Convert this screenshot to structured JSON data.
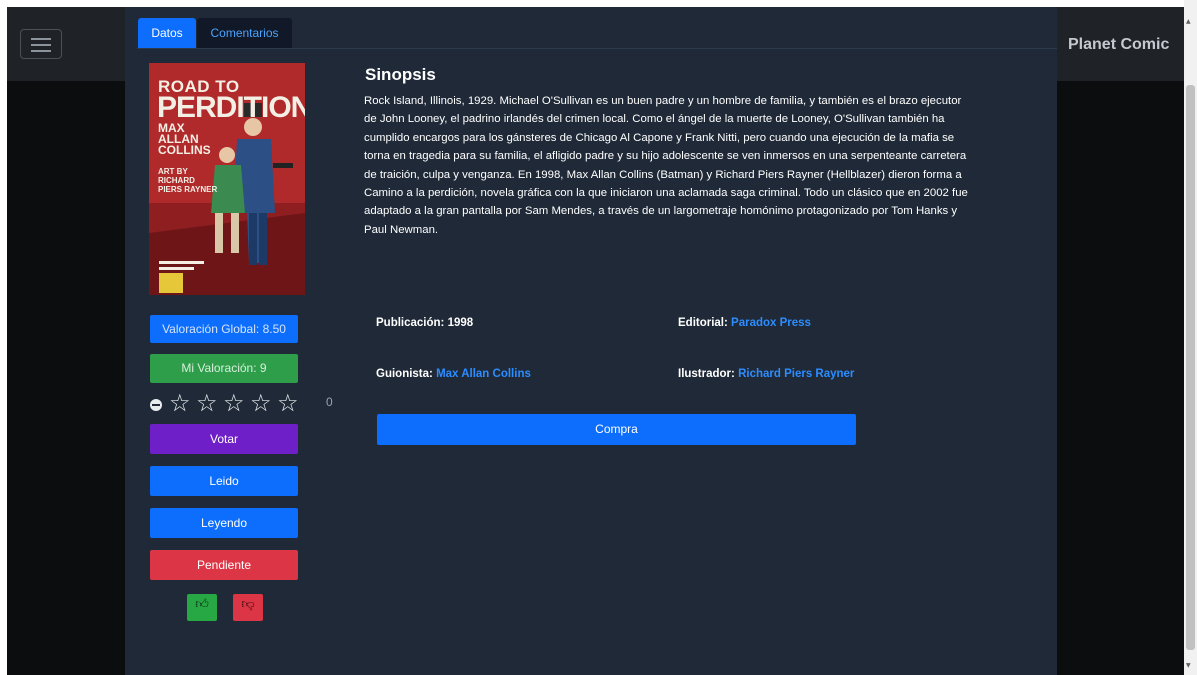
{
  "navbar": {
    "brand": "Planet Comic"
  },
  "tabs": [
    {
      "label": "Datos",
      "active": true
    },
    {
      "label": "Comentarios",
      "active": false
    }
  ],
  "cover": {
    "title_line1": "ROAD TO",
    "title_line2": "PERDITION",
    "author": "MAX ALLAN COLLINS",
    "art": "ART BY RICHARD PIERS RAYNER"
  },
  "ratings": {
    "global_label": "Valoración Global: 8.50",
    "mine_label": "Mi Valoración: 9",
    "stars_total": 5,
    "count": "0"
  },
  "actions": {
    "votar": "Votar",
    "leido": "Leido",
    "leyendo": "Leyendo",
    "pendiente": "Pendiente",
    "like_icon": "thumbs-up-icon",
    "dislike_icon": "thumbs-down-icon"
  },
  "sinopsis": {
    "title": "Sinopsis",
    "text": "Rock Island, Illinois, 1929. Michael O'Sullivan es un buen padre y un hombre de familia, y también es el brazo ejecutor de John Looney, el padrino irlandés del crimen local. Como el ángel de la muerte de Looney, O'Sullivan también ha cumplido encargos para los gánsteres de Chicago Al Capone y Frank Nitti, pero cuando una ejecución de la mafia se torna en tragedia para su familia, el afligido padre y su hijo adolescente se ven inmersos en una serpenteante carretera de traición, culpa y venganza. En 1998, Max Allan Collins (Batman) y Richard Piers Rayner (Hellblazer) dieron forma a Camino a la perdición, novela gráfica con la que iniciaron una aclamada saga criminal. Todo un clásico que en 2002 fue adaptado a la gran pantalla por Sam Mendes, a través de un largometraje homónimo protagonizado por Tom Hanks y Paul Newman."
  },
  "details": {
    "publicacion_label": "Publicación: 1998",
    "editorial_label": "Editorial:",
    "editorial_value": "Paradox Press",
    "guionista_label": "Guionista:",
    "guionista_value": "Max Allan Collins",
    "ilustrador_label": "Ilustrador:",
    "ilustrador_value": "Richard Piers Rayner"
  },
  "buy_button": "Compra",
  "colors": {
    "primary": "#0d6efd",
    "success": "#2e9e4b",
    "purple": "#6f1fc7",
    "danger": "#dc3545",
    "link": "#2c8dff",
    "modal_bg": "#1f2937"
  }
}
